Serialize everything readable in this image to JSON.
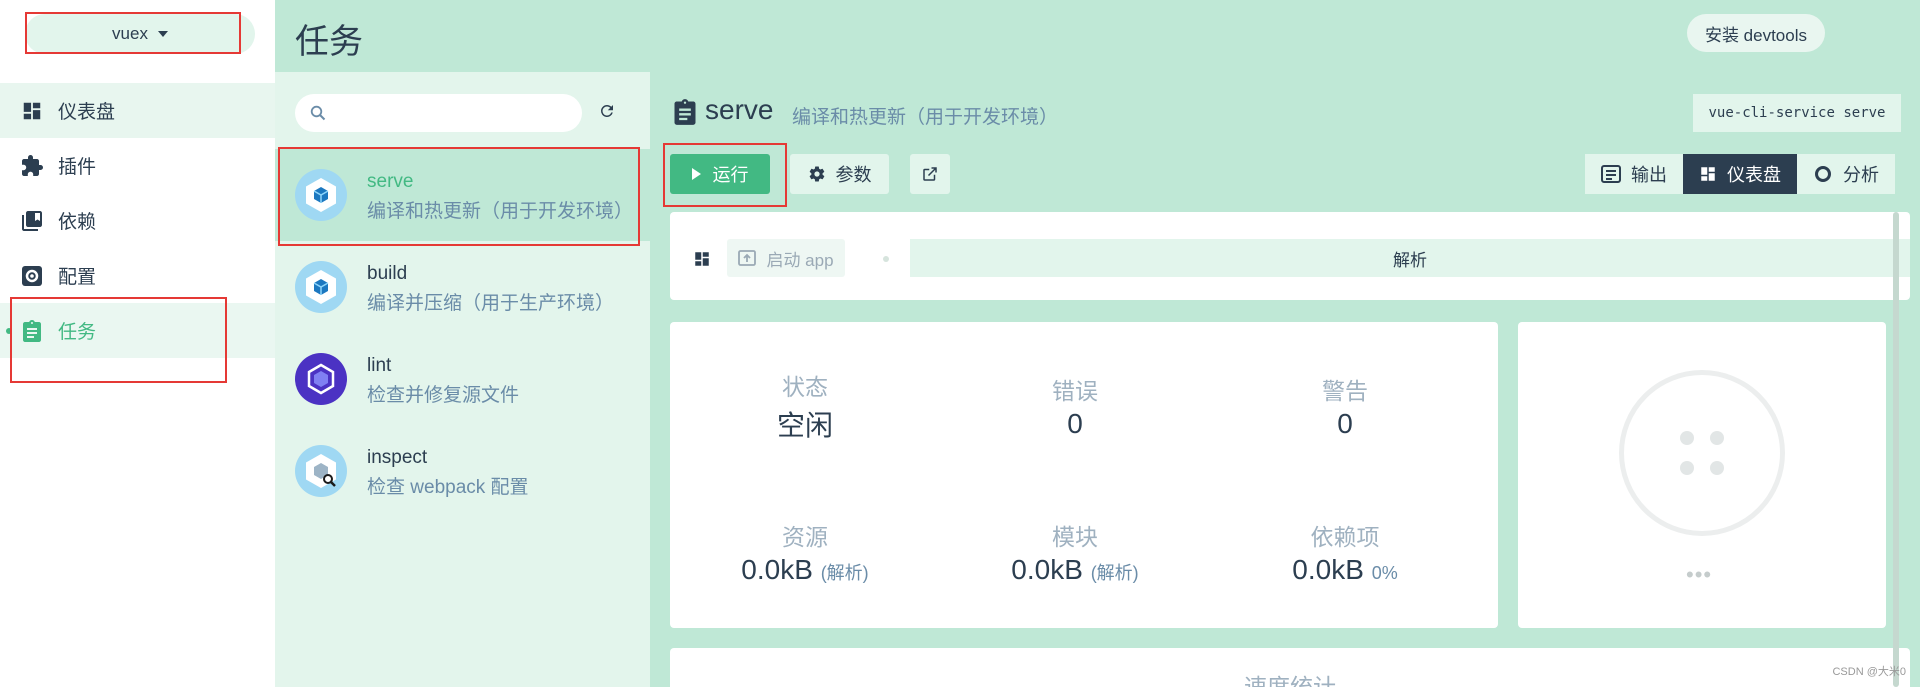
{
  "sidebar": {
    "project": "vuex",
    "items": [
      {
        "label": "仪表盘",
        "icon": "dashboard-icon"
      },
      {
        "label": "插件",
        "icon": "puzzle-icon"
      },
      {
        "label": "依赖",
        "icon": "library-icon"
      },
      {
        "label": "配置",
        "icon": "gear-icon"
      },
      {
        "label": "任务",
        "icon": "clipboard-icon"
      }
    ],
    "selected": "任务"
  },
  "header": {
    "title": "任务",
    "devtools_label": "安装 devtools"
  },
  "tasks": [
    {
      "name": "serve",
      "description": "编译和热更新（用于开发环境）",
      "selected": true
    },
    {
      "name": "build",
      "description": "编译并压缩（用于生产环境）"
    },
    {
      "name": "lint",
      "description": "检查并修复源文件"
    },
    {
      "name": "inspect",
      "description": "检查 webpack 配置"
    }
  ],
  "main": {
    "task_name": "serve",
    "task_description": "编译和热更新（用于开发环境）",
    "command": "vue-cli-service serve",
    "run_label": "运行",
    "params_label": "参数",
    "view_tabs": [
      {
        "label": "输出",
        "icon": "terminal-icon"
      },
      {
        "label": "仪表盘",
        "icon": "dashboard-icon",
        "active": true
      },
      {
        "label": "分析",
        "icon": "donut-icon"
      }
    ],
    "dashboard": {
      "start_app_label": "启动 app",
      "parse_label": "解析"
    },
    "stats": {
      "status_label": "状态",
      "status_value": "空闲",
      "errors_label": "错误",
      "errors_value": "0",
      "warnings_label": "警告",
      "warnings_value": "0",
      "assets_label": "资源",
      "assets_value": "0.0kB",
      "assets_unit": "(解析)",
      "modules_label": "模块",
      "modules_value": "0.0kB",
      "modules_unit": "(解析)",
      "deps_label": "依赖项",
      "deps_value": "0.0kB",
      "deps_percent": "0%"
    },
    "status_ellipsis": "•••",
    "speed_title": "速度统计"
  },
  "watermark": "CSDN @大米0"
}
